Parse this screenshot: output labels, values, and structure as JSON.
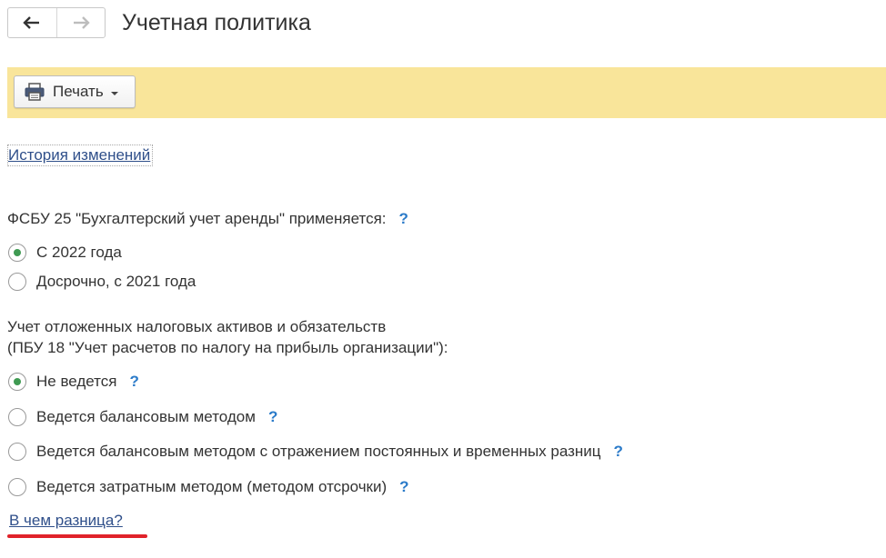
{
  "header": {
    "title": "Учетная политика"
  },
  "toolbar": {
    "print_label": "Печать"
  },
  "links": {
    "history": "История изменений",
    "difference": "В чем разница?"
  },
  "fsbu25": {
    "label": "ФСБУ 25 \"Бухгалтерский учет аренды\" применяется:",
    "help": "?",
    "options": [
      {
        "label": "С 2022 года",
        "checked": true
      },
      {
        "label": "Досрочно, с 2021 года",
        "checked": false
      }
    ]
  },
  "pbu18": {
    "label_line1": "Учет отложенных налоговых активов и обязательств",
    "label_line2": "(ПБУ 18 \"Учет расчетов по налогу на прибыль организации\"):",
    "help": "?",
    "options": [
      {
        "label": "Не ведется",
        "checked": true,
        "help": "?"
      },
      {
        "label": "Ведется балансовым методом",
        "checked": false,
        "help": "?"
      },
      {
        "label": "Ведется балансовым методом с отражением постоянных и временных разниц",
        "checked": false,
        "help": "?"
      },
      {
        "label": "Ведется затратным методом (методом отсрочки)",
        "checked": false,
        "help": "?"
      }
    ]
  },
  "colors": {
    "toolbar_bg": "#f9e59a",
    "link": "#2f4f8a",
    "help": "#2b7bc9",
    "radio_checked": "#3f9a52",
    "annotation_underline": "#e0222a"
  },
  "icons": {
    "back": "arrow-left-icon",
    "forward": "arrow-right-icon",
    "print": "printer-icon",
    "dropdown": "caret-down-icon"
  }
}
